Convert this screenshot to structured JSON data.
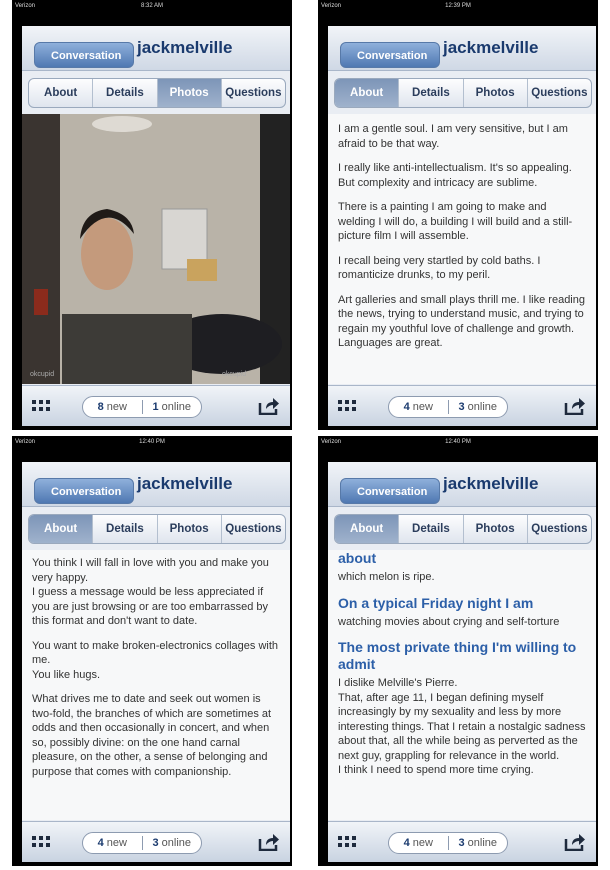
{
  "panels": [
    {
      "status": {
        "carrier": "Verizon",
        "time": "8:32 AM",
        "right": ""
      },
      "nav": {
        "back": "Conversation",
        "title": "jackmelville"
      },
      "tabs": [
        "About",
        "Details",
        "Photos",
        "Questions"
      ],
      "active_tab": 2,
      "toolbar": {
        "new_count": "8",
        "new_label": "new",
        "online_count": "1",
        "online_label": "online"
      }
    },
    {
      "status": {
        "carrier": "Verizon",
        "time": "12:39 PM",
        "right": ""
      },
      "nav": {
        "back": "Conversation",
        "title": "jackmelville"
      },
      "tabs": [
        "About",
        "Details",
        "Photos",
        "Questions"
      ],
      "active_tab": 0,
      "paragraphs": [
        "I am a gentle soul. I am very sensitive, but I am afraid to be that way.",
        "I really like anti-intellectualism. It's so appealing. But complexity and intricacy are sublime.",
        "There is a painting I am going to make and welding I will do, a building I will build and a still-picture film I will assemble.",
        "I recall being very startled by cold baths. I romanticize drunks, to my peril.",
        "Art galleries and small plays thrill me. I like reading the news, trying to understand music, and trying to regain my youthful love of challenge and growth. Languages are great."
      ],
      "toolbar": {
        "new_count": "4",
        "new_label": "new",
        "online_count": "3",
        "online_label": "online"
      }
    },
    {
      "status": {
        "carrier": "Verizon",
        "time": "12:40 PM",
        "right": ""
      },
      "nav": {
        "back": "Conversation",
        "title": "jackmelville"
      },
      "tabs": [
        "About",
        "Details",
        "Photos",
        "Questions"
      ],
      "active_tab": 0,
      "paragraphs": [
        "You think I will fall in love with you and make you very happy.\nI guess a message would be less appreciated if you are just browsing or are too embarrassed by this format and don't want to date.",
        "You want to make broken-electronics collages with me.\nYou like hugs.",
        "What drives me to date and seek out women is two-fold, the branches of which are sometimes at odds and then occasionally in concert, and when so, possibly divine: on the one hand carnal pleasure, on the other, a sense of belonging and purpose that comes with companionship."
      ],
      "toolbar": {
        "new_count": "4",
        "new_label": "new",
        "online_count": "3",
        "online_label": "online"
      }
    },
    {
      "status": {
        "carrier": "Verizon",
        "time": "12:40 PM",
        "right": ""
      },
      "nav": {
        "back": "Conversation",
        "title": "jackmelville"
      },
      "tabs": [
        "About",
        "Details",
        "Photos",
        "Questions"
      ],
      "active_tab": 0,
      "top_heading": "about",
      "top_text": "which melon is ripe.",
      "heading1": "On a typical Friday night I am",
      "text1": "watching movies about crying and self-torture",
      "heading2": "The most private thing I'm willing to admit",
      "text2": "I dislike Melville's Pierre.\nThat, after age 11, I began defining myself increasingly by my sexuality and less by more interesting things. That I retain a nostalgic sadness about that, all the while being as perverted as the next guy, grappling for relevance in the world.\nI think I need to spend more time crying.",
      "toolbar": {
        "new_count": "4",
        "new_label": "new",
        "online_count": "3",
        "online_label": "online"
      }
    }
  ],
  "colors": {
    "title": "#1a3a6e",
    "heading": "#2c5fa8",
    "back_button": "#4f78b2",
    "active_tab": "#8aa0c0"
  }
}
